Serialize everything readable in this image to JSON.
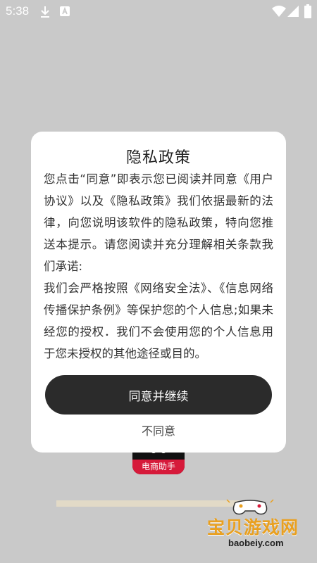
{
  "status_bar": {
    "time": "5:38",
    "icons": [
      "download-icon",
      "app-notification-icon",
      "wifi-icon",
      "cellular-signal-icon",
      "battery-icon"
    ]
  },
  "background_app": {
    "icon_label": "电商助手"
  },
  "dialog": {
    "title": "隐私政策",
    "paragraphs": [
      "您点击“同意”即表示您已阅读并同意《用户协议》以及《隐私政策》我们依据最新的法律，向您说明该软件的隐私政策，特向您推送本提示。请您阅读并充分理解相关条款我们承诺:",
      "我们会严格按照《网络安全法》、《信息网络传播保护条例》等保护您的个人信息;如果未经您的授权．我们不会使用您的个人信息用于您未授权的其他途径或目的。"
    ],
    "agree_label": "同意并继续",
    "disagree_label": "不同意",
    "accent_color": "#2b2b2b"
  },
  "watermark": {
    "text": "宝贝游戏网",
    "domain": "baobeiy.com"
  }
}
